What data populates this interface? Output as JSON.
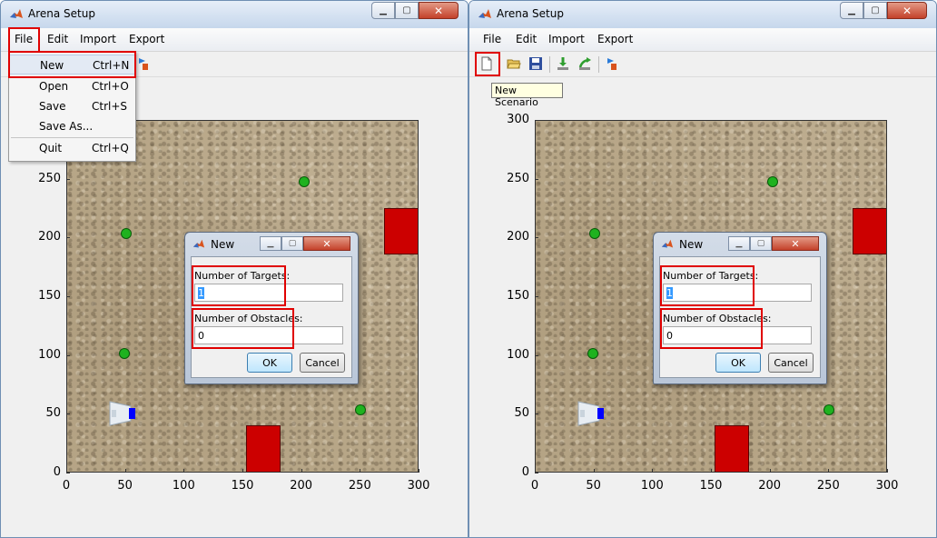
{
  "window": {
    "title": "Arena Setup"
  },
  "menubar": {
    "items": [
      "File",
      "Edit",
      "Import",
      "Export"
    ]
  },
  "file_menu": {
    "items": [
      {
        "label": "New",
        "accel": "Ctrl+N"
      },
      {
        "label": "Open",
        "accel": "Ctrl+O"
      },
      {
        "label": "Save",
        "accel": "Ctrl+S"
      },
      {
        "label": "Save As...",
        "accel": ""
      },
      {
        "label": "Quit",
        "accel": "Ctrl+Q"
      }
    ]
  },
  "toolbar": {
    "icons": [
      "new-file-icon",
      "open-folder-icon",
      "save-icon",
      "import-icon",
      "export-icon",
      "run-icon"
    ],
    "tooltip": "New Scenario"
  },
  "dialog": {
    "title": "New",
    "targets_label": "Number of Targets:",
    "targets_value": "1",
    "obstacles_label": "Number of Obstacles:",
    "obstacles_value": "0",
    "ok_label": "OK",
    "cancel_label": "Cancel"
  },
  "arena": {
    "x_ticks": [
      "0",
      "50",
      "100",
      "150",
      "200",
      "250",
      "300"
    ],
    "y_ticks": [
      "0",
      "50",
      "100",
      "150",
      "200",
      "250",
      "300"
    ],
    "xlim": [
      0,
      300
    ],
    "ylim": [
      0,
      300
    ],
    "targets": [
      {
        "x": 202,
        "y": 248
      },
      {
        "x": 50,
        "y": 204
      },
      {
        "x": 49,
        "y": 102
      },
      {
        "x": 250,
        "y": 54
      }
    ],
    "obstacles": [
      {
        "x0": 270,
        "x1": 300,
        "y0": 186,
        "y1": 226
      },
      {
        "x0": 152,
        "x1": 182,
        "y0": 1,
        "y1": 41
      }
    ],
    "robot": {
      "x": 45,
      "y": 52
    },
    "colors": {
      "target": "#1fb21f",
      "obstacle": "#cc0000",
      "robot": "#0000ff"
    }
  }
}
